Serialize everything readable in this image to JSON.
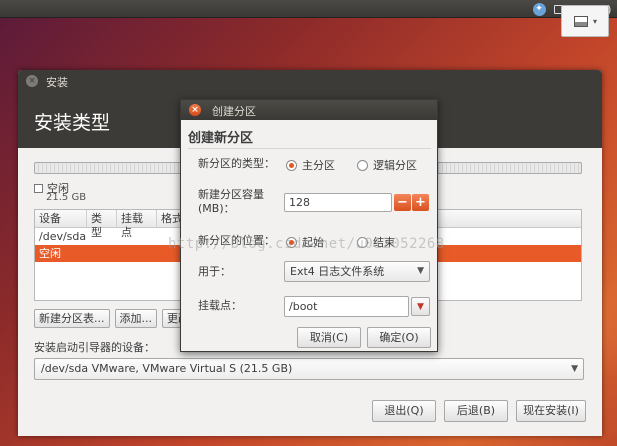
{
  "top_panel": {
    "tray_icons": [
      "accessibility-icon",
      "keyboard-icon",
      "network-icon",
      "volume-icon"
    ],
    "popup_icon": "image-icon"
  },
  "installer": {
    "window_title": "安装",
    "heading": "安装类型",
    "free_label": "空闲",
    "free_size": "21.5 GB",
    "columns": [
      "设备",
      "类型",
      "挂载点",
      "格式"
    ],
    "rows": [
      {
        "device": "/dev/sda",
        "selected": false
      },
      {
        "device": "空闲",
        "selected": true
      }
    ],
    "buttons": {
      "new_table": "新建分区表...",
      "add": "添加...",
      "change": "更改"
    },
    "boot_label": "安装启动引导器的设备：",
    "boot_device": "/dev/sda  VMware, VMware Virtual S (21.5 GB)",
    "nav": {
      "quit": "退出(Q)",
      "back": "后退(B)",
      "install": "现在安装(I)"
    },
    "accent_color": "#e85b29"
  },
  "dialog": {
    "window_title": "创建分区",
    "heading": "创建新分区",
    "type_label": "新分区的类型：",
    "type_primary": "主分区",
    "type_logical": "逻辑分区",
    "type_selected": "主分区",
    "size_label": "新建分区容量\n(MB)：",
    "size_value": "128",
    "position_label": "新分区的位置：",
    "pos_start": "起始",
    "pos_end": "结束",
    "pos_selected": "起始",
    "use_label": "用于：",
    "use_value": "Ext4 日志文件系统",
    "mount_label": "挂载点：",
    "mount_value": "/boot",
    "cancel": "取消(C)",
    "ok": "确定(O)"
  },
  "watermark": "http://blog.csdn.net/u012052268"
}
